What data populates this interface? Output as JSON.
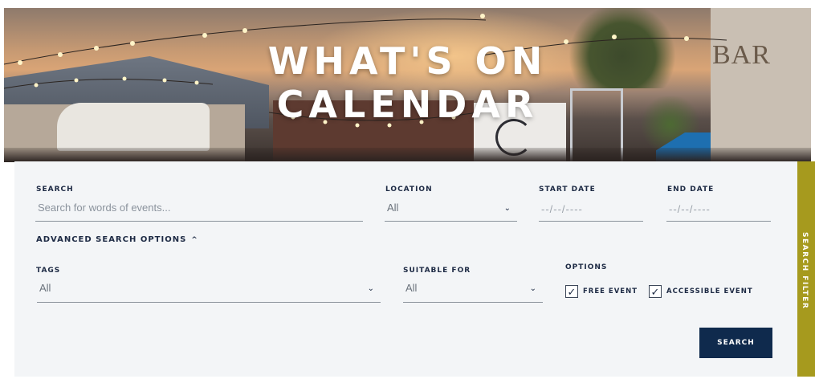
{
  "hero": {
    "title_line1": "WHAT'S ON",
    "title_line2": "CALENDAR",
    "sign_text": "BAR"
  },
  "search": {
    "label": "SEARCH",
    "placeholder": "Search for words of events..."
  },
  "location": {
    "label": "LOCATION",
    "value": "All"
  },
  "start_date": {
    "label": "START DATE",
    "value": "--/--/----"
  },
  "end_date": {
    "label": "END DATE",
    "value": "--/--/----"
  },
  "advanced": {
    "label": "ADVANCED SEARCH OPTIONS",
    "caret": "^"
  },
  "tags": {
    "label": "TAGS",
    "value": "All"
  },
  "suitable_for": {
    "label": "SUITABLE FOR",
    "value": "All"
  },
  "options": {
    "label": "OPTIONS",
    "free_event": {
      "label": "FREE EVENT",
      "checked": true
    },
    "accessible_event": {
      "label": "ACCESSIBLE EVENT",
      "checked": true
    }
  },
  "search_button": {
    "label": "SEARCH"
  },
  "side_tab": {
    "label": "SEARCH FILTER"
  },
  "colors": {
    "navy": "#0f2a4d",
    "side_tab": "#a69a1e",
    "panel_bg": "#f3f5f7"
  }
}
